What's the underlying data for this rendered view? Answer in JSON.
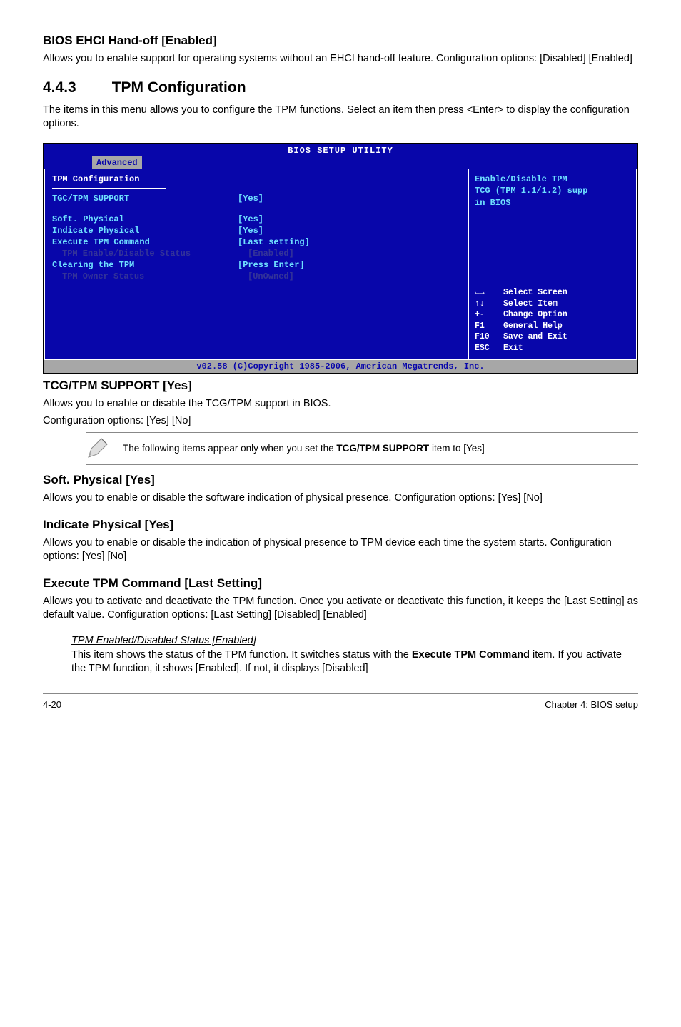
{
  "s1": {
    "heading": "BIOS EHCI Hand-off [Enabled]",
    "body": "Allows you to enable support for operating systems without an EHCI hand-off feature. Configuration options: [Disabled] [Enabled]"
  },
  "sec443": {
    "number": "4.4.3",
    "title": "TPM Configuration",
    "body": "The items in this menu allows you to configure the TPM functions. Select an item then press <Enter> to display the configuration options."
  },
  "bios": {
    "title": "BIOS SETUP UTILITY",
    "tab": "Advanced",
    "left": {
      "heading": "TPM Configuration",
      "rows": [
        {
          "label": "TGC/TPM SUPPORT",
          "value": "[Yes]",
          "dim": false,
          "indent": false,
          "gap": true
        },
        {
          "label": "Soft. Physical",
          "value": "[Yes]",
          "dim": false,
          "indent": false
        },
        {
          "label": "Indicate Physical",
          "value": "[Yes]",
          "dim": false,
          "indent": false
        },
        {
          "label": "Execute TPM Command",
          "value": "[Last setting]",
          "dim": false,
          "indent": false
        },
        {
          "label": "TPM Enable/Disable Status",
          "value": "[Enabled]",
          "dim": true,
          "indent": true
        },
        {
          "label": "Clearing the TPM",
          "value": "[Press Enter]",
          "dim": false,
          "indent": false
        },
        {
          "label": "TPM Owner Status",
          "value": "[UnOwned]",
          "dim": true,
          "indent": true
        }
      ]
    },
    "right": {
      "help1": "Enable/Disable TPM",
      "help2": "TCG (TPM 1.1/1.2) supp",
      "help3": "in BIOS",
      "nav": [
        {
          "key": "←→",
          "txt": "Select Screen"
        },
        {
          "key": "↑↓",
          "txt": "Select Item"
        },
        {
          "key": "+-",
          "txt": "Change Option"
        },
        {
          "key": "F1",
          "txt": "General Help"
        },
        {
          "key": "F10",
          "txt": "Save and Exit"
        },
        {
          "key": "ESC",
          "txt": "Exit"
        }
      ]
    },
    "footer": "v02.58 (C)Copyright 1985-2006, American Megatrends, Inc."
  },
  "tcg": {
    "heading": "TCG/TPM SUPPORT [Yes]",
    "body1": "Allows you to enable or disable the TCG/TPM support in BIOS.",
    "body2": "Configuration options: [Yes] [No]"
  },
  "note": {
    "pre": "The following items appear only when you set the ",
    "bold": "TCG/TPM SUPPORT",
    "post": " item to [Yes]"
  },
  "soft": {
    "heading": "Soft. Physical [Yes]",
    "body": "Allows you to enable or disable the software indication of physical presence. Configuration options: [Yes] [No]"
  },
  "ind": {
    "heading": "Indicate Physical [Yes]",
    "body": "Allows you to enable or disable the indication of physical presence to TPM device each time the system starts. Configuration options: [Yes] [No]"
  },
  "exec": {
    "heading": "Execute TPM Command [Last Setting]",
    "body": "Allows you to activate and deactivate the TPM function. Once you activate or deactivate this function, it keeps the [Last Setting] as default value. Configuration options: [Last Setting] [Disabled] [Enabled]"
  },
  "tpmstatus": {
    "title": "TPM Enabled/Disabled Status [Enabled]",
    "pre": "This item shows the status of the TPM function. It switches status with the ",
    "bold": "Execute TPM Command",
    "post": " item. If you activate the TPM function, it shows [Enabled]. If not, it displays [Disabled]"
  },
  "footer": {
    "left": "4-20",
    "right": "Chapter 4: BIOS setup"
  }
}
